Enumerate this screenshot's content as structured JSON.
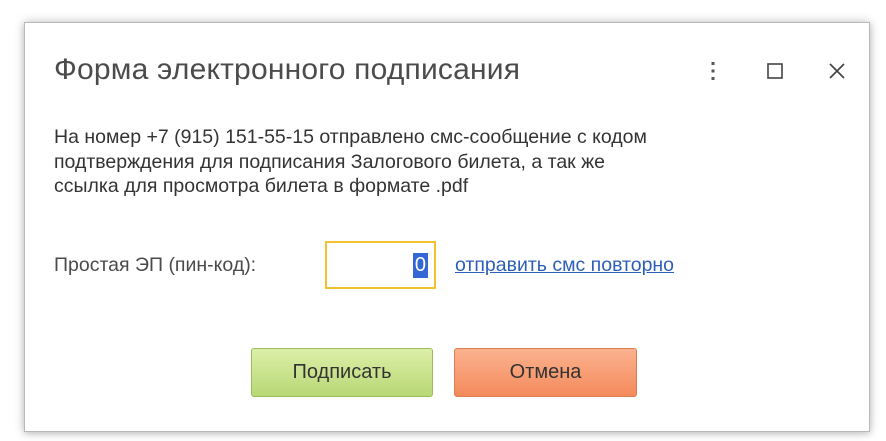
{
  "dialog": {
    "title": "Форма электронного подписания",
    "controls": {
      "more_icon": "more-vertical-icon",
      "maximize_icon": "maximize-icon",
      "close_icon": "close-icon"
    },
    "message_lines": [
      "На номер +7 (915) 151-55-15 отправлено смс-сообщение с кодом",
      "подтверждения для подписания Залогового билета, а так же",
      "ссылка для просмотра билета в формате .pdf"
    ],
    "pin": {
      "label": "Простая ЭП (пин-код):",
      "value": "0",
      "highlight_color": "#f2c230"
    },
    "resend_link": "отправить смс повторно",
    "buttons": {
      "sign_label": "Подписать",
      "cancel_label": "Отмена"
    },
    "colors": {
      "sign_button": "#c6e08c",
      "cancel_button": "#f59a70",
      "link": "#2d5fb8",
      "selection": "#3367d6"
    }
  }
}
